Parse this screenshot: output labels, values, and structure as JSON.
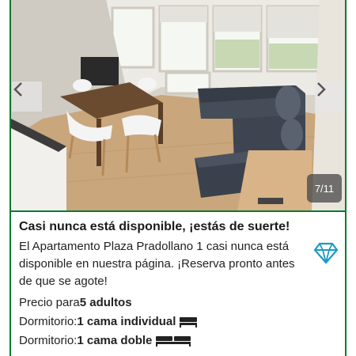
{
  "gallery": {
    "counter": "7/11",
    "prev_icon": "chevron-left-icon",
    "next_icon": "chevron-right-icon"
  },
  "promo": {
    "headline": "Casi nunca está disponible, ¡estás de suerte!",
    "description": "El Apartamento Plaza Pradollano 1 casi nunca está disponible en nuestra página. ¡Reserva pronto antes de que se agote!",
    "icon": "diamond-icon"
  },
  "details": {
    "price_prefix": "Precio para ",
    "price_value": "5 adultos",
    "bedroom1_label": "Dormitorio: ",
    "bedroom1_value": "1 cama individual",
    "bedroom2_label": "Dormitorio: ",
    "bedroom2_value": "1 cama doble"
  },
  "colors": {
    "accent_green": "#0b7a32",
    "diamond_teal": "#1a9bc4"
  }
}
